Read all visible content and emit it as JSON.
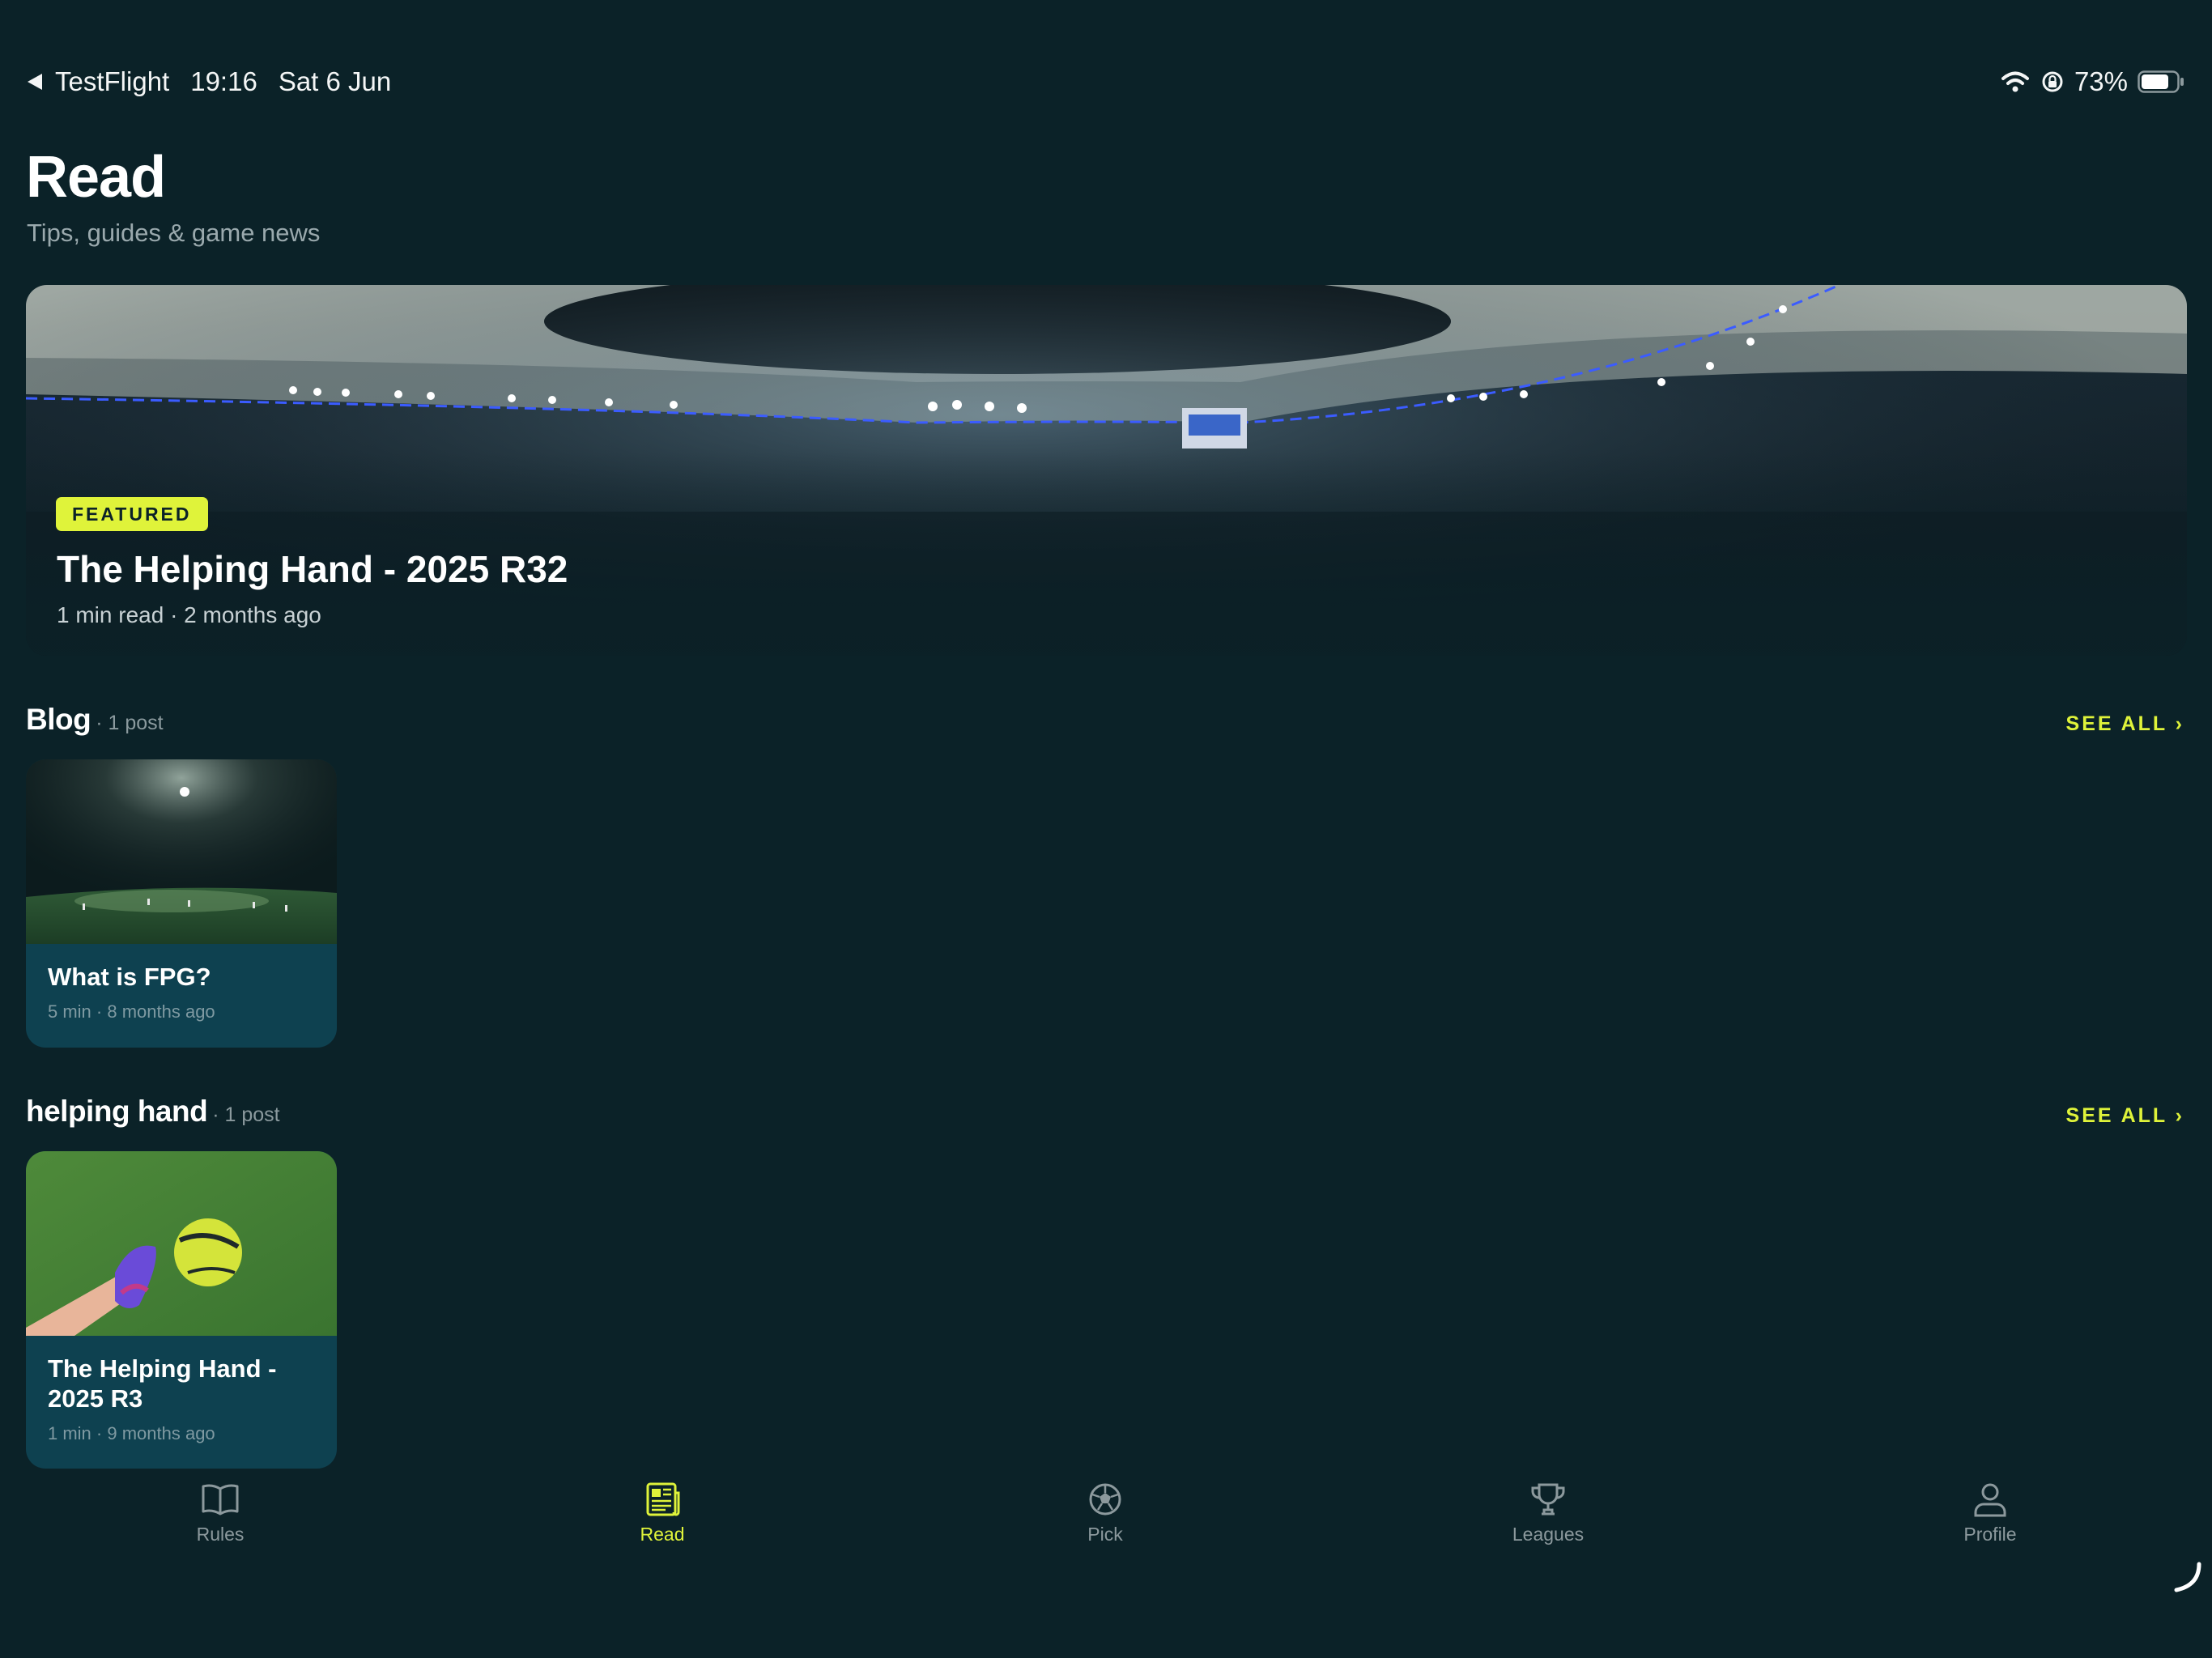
{
  "status_bar": {
    "back_app": "TestFlight",
    "time": "19:16",
    "date": "Sat 6 Jun",
    "battery": "73%",
    "icons": [
      "back-arrow-icon",
      "wifi-icon",
      "orientation-lock-icon",
      "battery-icon"
    ]
  },
  "header": {
    "title": "Read",
    "subtitle": "Tips, guides & game news"
  },
  "featured": {
    "badge": "FEATURED",
    "title": "The Helping Hand - 2025 R32",
    "meta": "1 min read · 2 months ago",
    "image": "stadium-night-panorama"
  },
  "sections": [
    {
      "title": "Blog",
      "count": "· 1 post",
      "see_all": "SEE ALL ›",
      "posts": [
        {
          "title": "What is FPG?",
          "meta": "5 min · 8 months ago",
          "image": "floodlit-pitch"
        }
      ]
    },
    {
      "title": "helping hand",
      "count": "· 1 post",
      "see_all": "SEE ALL ›",
      "posts": [
        {
          "title": "The Helping Hand - 2025 R3",
          "meta": "1 min · 9 months ago",
          "image": "football-on-grass"
        }
      ]
    }
  ],
  "tab_bar": {
    "active": "Read",
    "tabs": [
      {
        "label": "Rules",
        "icon": "book-icon"
      },
      {
        "label": "Read",
        "icon": "newspaper-icon"
      },
      {
        "label": "Pick",
        "icon": "soccer-ball-icon"
      },
      {
        "label": "Leagues",
        "icon": "trophy-icon"
      },
      {
        "label": "Profile",
        "icon": "person-icon"
      }
    ]
  },
  "colors": {
    "background": "#0b2228",
    "accent": "#dff33a",
    "card": "#0e4150",
    "muted_text": "#8c999d"
  }
}
